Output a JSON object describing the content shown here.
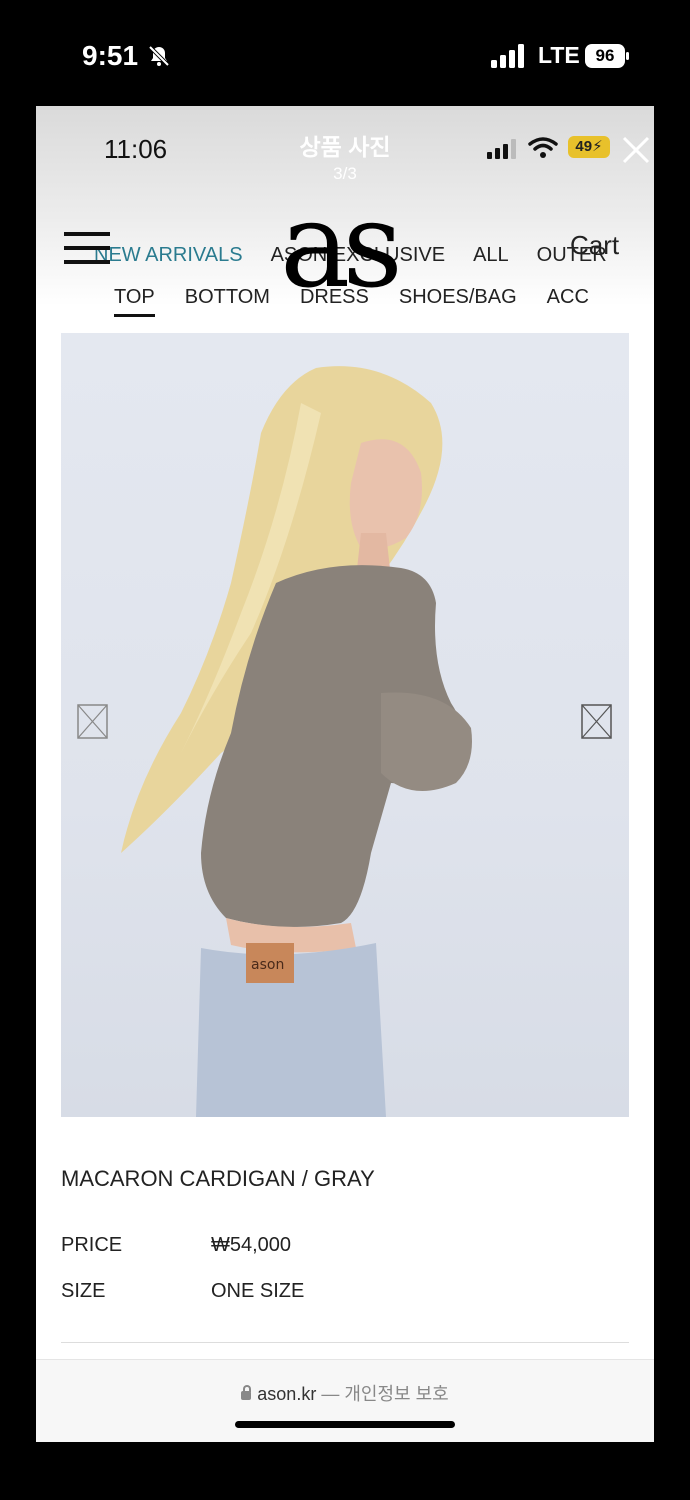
{
  "phone_status": {
    "time": "9:51",
    "network": "LTE",
    "battery": "96",
    "icons": [
      "bell-muted-icon",
      "signal-icon"
    ]
  },
  "viewer": {
    "title": "상품 사진",
    "counter": "3/3",
    "close_icon": "close-icon"
  },
  "inner_status": {
    "time": "11:06",
    "battery": "49",
    "battery_color": "#e8c12b",
    "icons": [
      "signal-icon",
      "wifi-icon",
      "charging-battery-icon"
    ]
  },
  "site": {
    "logo": "as",
    "cart_label": "Cart",
    "menu_icon": "hamburger-icon",
    "nav_primary": [
      "NEW ARRIVALS",
      "ASON EXCLUSIVE",
      "ALL",
      "OUTER"
    ],
    "nav_secondary": [
      "TOP",
      "BOTTOM",
      "DRESS",
      "SHOES/BAG",
      "ACC"
    ],
    "active_primary": "NEW ARRIVALS",
    "active_secondary": "TOP",
    "accent_color": "#2a7b8f"
  },
  "product": {
    "image_label": "ason",
    "name": "MACARON CARDIGAN / GRAY",
    "price_label": "PRICE",
    "price_value": "₩54,000",
    "size_label": "SIZE",
    "size_value": "ONE SIZE"
  },
  "browser": {
    "domain": "ason.kr",
    "separator": "—",
    "privacy": "개인정보 보호"
  }
}
